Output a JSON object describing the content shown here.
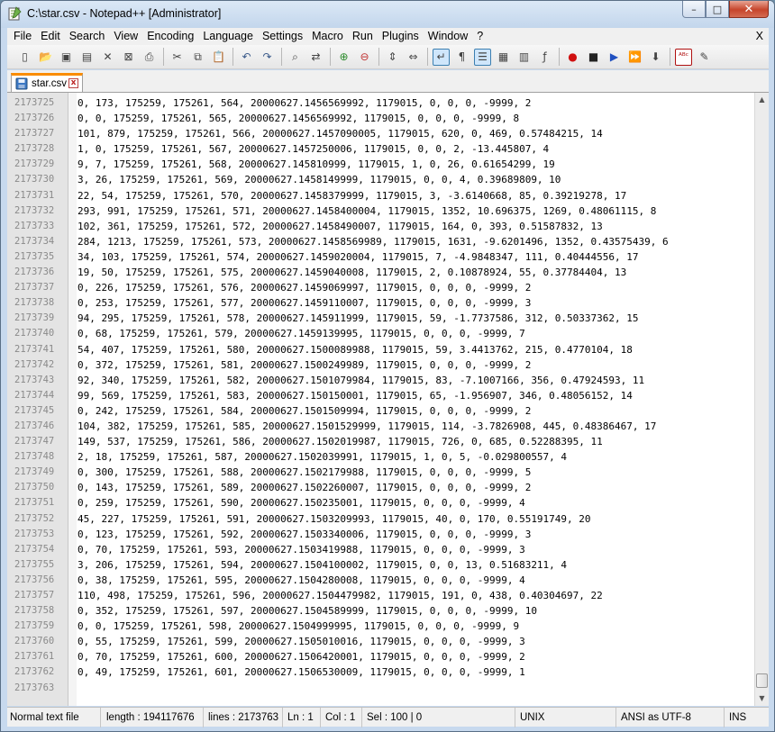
{
  "window": {
    "title": "C:\\star.csv - Notepad++ [Administrator]",
    "min_glyph": "–",
    "max_glyph": "□",
    "close_glyph": "✕"
  },
  "menu": {
    "items": [
      "File",
      "Edit",
      "Search",
      "View",
      "Encoding",
      "Language",
      "Settings",
      "Macro",
      "Run",
      "Plugins",
      "Window",
      "?"
    ],
    "close": "X"
  },
  "toolbar": {
    "icons": [
      "new-file-icon",
      "open-file-icon",
      "save-icon",
      "save-all-icon",
      "close-icon",
      "close-all-icon",
      "print-icon",
      "|",
      "cut-icon",
      "copy-icon",
      "paste-icon",
      "|",
      "undo-icon",
      "redo-icon",
      "|",
      "find-icon",
      "replace-icon",
      "|",
      "zoom-in-icon",
      "zoom-out-icon",
      "|",
      "sync-vertical-icon",
      "sync-horizontal-icon",
      "|",
      "word-wrap-icon",
      "show-all-chars-icon",
      "indent-guide-icon",
      "user-language-icon",
      "doc-map-icon",
      "function-list-icon",
      "|",
      "record-macro-icon",
      "stop-record-icon",
      "play-macro-icon",
      "play-multiple-icon",
      "save-macro-icon",
      "|",
      "spell-check-icon",
      "spell-options-icon"
    ]
  },
  "tab": {
    "label": "star.csv",
    "close_glyph": "x"
  },
  "editor": {
    "lines": [
      {
        "num": "2173725",
        "text": "0, 173, 175259, 175261, 564, 20000627.1456569992, 1179015, 0, 0, 0, -9999, 2"
      },
      {
        "num": "2173726",
        "text": "0, 0, 175259, 175261, 565, 20000627.1456569992, 1179015, 0, 0, 0, -9999, 8"
      },
      {
        "num": "2173727",
        "text": "101, 879, 175259, 175261, 566, 20000627.1457090005, 1179015, 620, 0, 469, 0.57484215, 14"
      },
      {
        "num": "2173728",
        "text": "1, 0, 175259, 175261, 567, 20000627.1457250006, 1179015, 0, 0, 2, -13.445807, 4"
      },
      {
        "num": "2173729",
        "text": "9, 7, 175259, 175261, 568, 20000627.145810999, 1179015, 1, 0, 26, 0.61654299, 19"
      },
      {
        "num": "2173730",
        "text": "3, 26, 175259, 175261, 569, 20000627.1458149999, 1179015, 0, 0, 4, 0.39689809, 10"
      },
      {
        "num": "2173731",
        "text": "22, 54, 175259, 175261, 570, 20000627.1458379999, 1179015, 3, -3.6140668, 85, 0.39219278, 17"
      },
      {
        "num": "2173732",
        "text": "293, 991, 175259, 175261, 571, 20000627.1458400004, 1179015, 1352, 10.696375, 1269, 0.48061115, 8"
      },
      {
        "num": "2173733",
        "text": "102, 361, 175259, 175261, 572, 20000627.1458490007, 1179015, 164, 0, 393, 0.51587832, 13"
      },
      {
        "num": "2173734",
        "text": "284, 1213, 175259, 175261, 573, 20000627.1458569989, 1179015, 1631, -9.6201496, 1352, 0.43575439, 6"
      },
      {
        "num": "2173735",
        "text": "34, 103, 175259, 175261, 574, 20000627.1459020004, 1179015, 7, -4.9848347, 111, 0.40444556, 17"
      },
      {
        "num": "2173736",
        "text": "19, 50, 175259, 175261, 575, 20000627.1459040008, 1179015, 2, 0.10878924, 55, 0.37784404, 13"
      },
      {
        "num": "2173737",
        "text": "0, 226, 175259, 175261, 576, 20000627.1459069997, 1179015, 0, 0, 0, -9999, 2"
      },
      {
        "num": "2173738",
        "text": "0, 253, 175259, 175261, 577, 20000627.1459110007, 1179015, 0, 0, 0, -9999, 3"
      },
      {
        "num": "2173739",
        "text": "94, 295, 175259, 175261, 578, 20000627.145911999, 1179015, 59, -1.7737586, 312, 0.50337362, 15"
      },
      {
        "num": "2173740",
        "text": "0, 68, 175259, 175261, 579, 20000627.1459139995, 1179015, 0, 0, 0, -9999, 7"
      },
      {
        "num": "2173741",
        "text": "54, 407, 175259, 175261, 580, 20000627.1500089988, 1179015, 59, 3.4413762, 215, 0.4770104, 18"
      },
      {
        "num": "2173742",
        "text": "0, 372, 175259, 175261, 581, 20000627.1500249989, 1179015, 0, 0, 0, -9999, 2"
      },
      {
        "num": "2173743",
        "text": "92, 340, 175259, 175261, 582, 20000627.1501079984, 1179015, 83, -7.1007166, 356, 0.47924593, 11"
      },
      {
        "num": "2173744",
        "text": "99, 569, 175259, 175261, 583, 20000627.150150001, 1179015, 65, -1.956907, 346, 0.48056152, 14"
      },
      {
        "num": "2173745",
        "text": "0, 242, 175259, 175261, 584, 20000627.1501509994, 1179015, 0, 0, 0, -9999, 2"
      },
      {
        "num": "2173746",
        "text": "104, 382, 175259, 175261, 585, 20000627.1501529999, 1179015, 114, -3.7826908, 445, 0.48386467, 17"
      },
      {
        "num": "2173747",
        "text": "149, 537, 175259, 175261, 586, 20000627.1502019987, 1179015, 726, 0, 685, 0.52288395, 11"
      },
      {
        "num": "2173748",
        "text": "2, 18, 175259, 175261, 587, 20000627.1502039991, 1179015, 1, 0, 5, -0.029800557, 4"
      },
      {
        "num": "2173749",
        "text": "0, 300, 175259, 175261, 588, 20000627.1502179988, 1179015, 0, 0, 0, -9999, 5"
      },
      {
        "num": "2173750",
        "text": "0, 143, 175259, 175261, 589, 20000627.1502260007, 1179015, 0, 0, 0, -9999, 2"
      },
      {
        "num": "2173751",
        "text": "0, 259, 175259, 175261, 590, 20000627.150235001, 1179015, 0, 0, 0, -9999, 4"
      },
      {
        "num": "2173752",
        "text": "45, 227, 175259, 175261, 591, 20000627.1503209993, 1179015, 40, 0, 170, 0.55191749, 20"
      },
      {
        "num": "2173753",
        "text": "0, 123, 175259, 175261, 592, 20000627.1503340006, 1179015, 0, 0, 0, -9999, 3"
      },
      {
        "num": "2173754",
        "text": "0, 70, 175259, 175261, 593, 20000627.1503419988, 1179015, 0, 0, 0, -9999, 3"
      },
      {
        "num": "2173755",
        "text": "3, 206, 175259, 175261, 594, 20000627.1504100002, 1179015, 0, 0, 13, 0.51683211, 4"
      },
      {
        "num": "2173756",
        "text": "0, 38, 175259, 175261, 595, 20000627.1504280008, 1179015, 0, 0, 0, -9999, 4"
      },
      {
        "num": "2173757",
        "text": "110, 498, 175259, 175261, 596, 20000627.1504479982, 1179015, 191, 0, 438, 0.40304697, 22"
      },
      {
        "num": "2173758",
        "text": "0, 352, 175259, 175261, 597, 20000627.1504589999, 1179015, 0, 0, 0, -9999, 10"
      },
      {
        "num": "2173759",
        "text": "0, 0, 175259, 175261, 598, 20000627.1504999995, 1179015, 0, 0, 0, -9999, 9"
      },
      {
        "num": "2173760",
        "text": "0, 55, 175259, 175261, 599, 20000627.1505010016, 1179015, 0, 0, 0, -9999, 3"
      },
      {
        "num": "2173761",
        "text": "0, 70, 175259, 175261, 600, 20000627.1506420001, 1179015, 0, 0, 0, -9999, 2"
      },
      {
        "num": "2173762",
        "text": "0, 49, 175259, 175261, 601, 20000627.1506530009, 1179015, 0, 0, 0, -9999, 1"
      },
      {
        "num": "2173763",
        "text": ""
      }
    ]
  },
  "status": {
    "file_type": "Normal text file",
    "length": "length : 194117676",
    "lines": "lines : 2173763",
    "ln": "Ln : 1",
    "col": "Col : 1",
    "sel": "Sel : 100 | 0",
    "eol": "UNIX",
    "encoding": "ANSI as UTF-8",
    "mode": "INS"
  },
  "colors": {
    "tab_accent": "#fa8c00",
    "titlebar": "#c7d9ee",
    "gutter": "#e4e4e4"
  }
}
